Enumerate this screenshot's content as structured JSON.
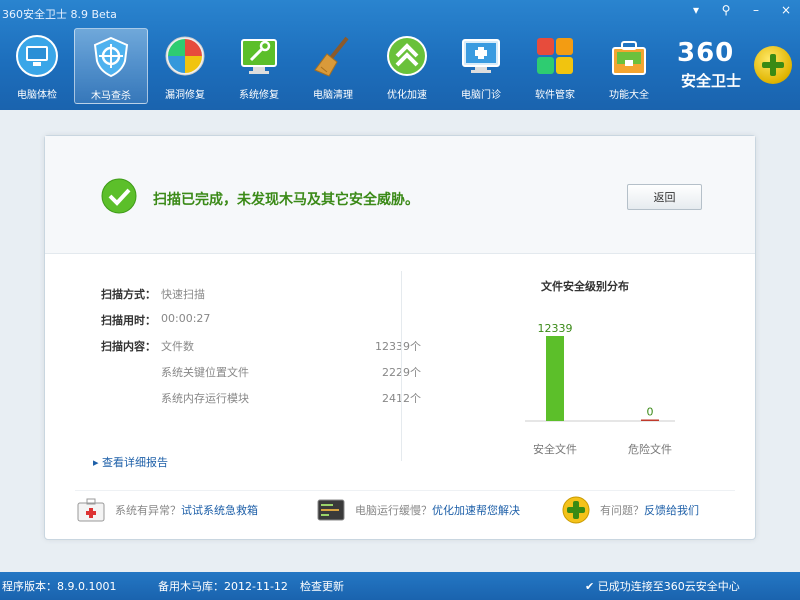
{
  "app": {
    "title": "360安全卫士 8.9 Beta",
    "brand_number": "360",
    "brand_name": "安全卫士"
  },
  "toolbar": [
    {
      "id": "checkup",
      "label": "电脑体检",
      "icon": "monitor-icon"
    },
    {
      "id": "trojan",
      "label": "木马查杀",
      "icon": "shield-icon",
      "active": true
    },
    {
      "id": "leak",
      "label": "漏洞修复",
      "icon": "windows-patch-icon"
    },
    {
      "id": "repair",
      "label": "系统修复",
      "icon": "wrench-monitor-icon"
    },
    {
      "id": "clean",
      "label": "电脑清理",
      "icon": "broom-icon"
    },
    {
      "id": "speedup",
      "label": "优化加速",
      "icon": "rocket-arrow-icon"
    },
    {
      "id": "clinic",
      "label": "电脑门诊",
      "icon": "doctor-monitor-icon"
    },
    {
      "id": "software",
      "label": "软件管家",
      "icon": "app-grid-icon"
    },
    {
      "id": "features",
      "label": "功能大全",
      "icon": "toolbox-icon"
    }
  ],
  "result": {
    "message": "扫描已完成，未发现木马及其它安全威胁。",
    "return_label": "返回"
  },
  "scan_info": {
    "method_label": "扫描方式：",
    "method_value": "快速扫描",
    "time_label": "扫描用时：",
    "time_value": "00:00:27",
    "content_label": "扫描内容：",
    "content_value": "文件数",
    "content_count": "12339个",
    "key_files_label": "系统关键位置文件",
    "key_files_count": "2229个",
    "memory_label": "系统内存运行模块",
    "memory_count": "2412个",
    "details_link": "查看详细报告"
  },
  "chart_data": {
    "type": "bar",
    "title": "文件安全级别分布",
    "categories": [
      "安全文件",
      "危险文件"
    ],
    "values": [
      12339,
      0
    ],
    "colors": [
      "#5cbf2a",
      "#c0392b"
    ],
    "ylim": [
      0,
      12339
    ]
  },
  "bottom_links": [
    {
      "prefix": "系统有异常？",
      "link": "试试系统急救箱",
      "icon": "first-aid-kit-icon"
    },
    {
      "prefix": "电脑运行缓慢？",
      "link": "优化加速帮您解决",
      "icon": "terminal-icon"
    },
    {
      "prefix": "有问题？",
      "link": "反馈给我们",
      "icon": "support-logo-icon"
    }
  ],
  "status": {
    "version": "程序版本：8.9.0.1001",
    "db": "备用木马库：2012-11-12",
    "update": "检查更新",
    "cloud": "已成功连接至360云安全中心"
  }
}
